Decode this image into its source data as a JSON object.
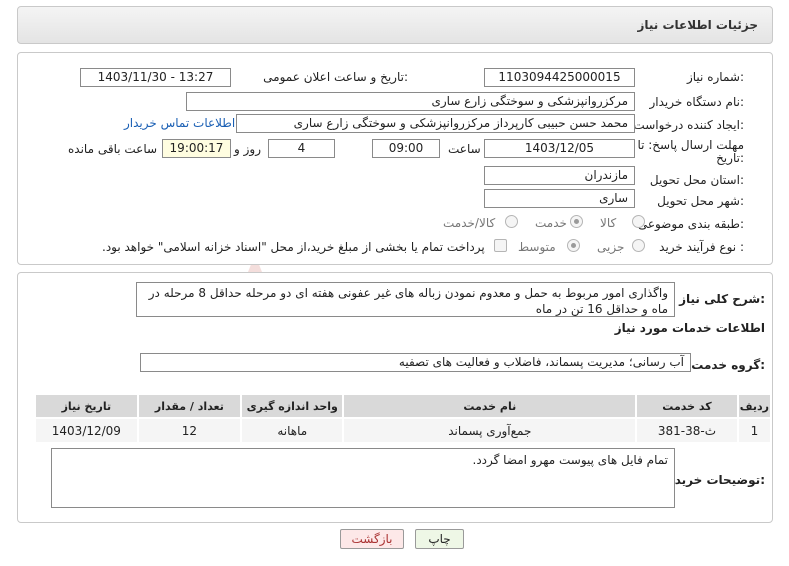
{
  "header": {
    "title": "جزئیات اطلاعات نیاز"
  },
  "fields": {
    "need_number_label": "شماره نیاز:",
    "need_number": "1103094425000015",
    "announce_label": "تاریخ و ساعت اعلان عمومی:",
    "announce_value": "1403/11/30 - 13:27",
    "buyer_org_label": "نام دستگاه خریدار:",
    "buyer_org": "مرکزروانپزشکی و سوختگی زارع ساری",
    "creator_label": "ایجاد کننده درخواست:",
    "creator": "محمد حسن حبیبی کارپرداز مرکزروانپزشکی و سوختگی زارع ساری",
    "contact_link": "اطلاعات تماس خریدار",
    "deadline_label_1": "مهلت ارسال پاسخ: تا",
    "deadline_label_2": "تاریخ:",
    "deadline_date": "1403/12/05",
    "time_label": "ساعت",
    "deadline_time": "09:00",
    "days_value": "4",
    "days_label": "روز و",
    "remaining_time": "19:00:17",
    "remaining_label": "ساعت باقی مانده",
    "province_label": "استان محل تحویل:",
    "province": "مازندران",
    "city_label": "شهر محل تحویل:",
    "city": "ساری",
    "category_label": "طبقه بندی موضوعی:",
    "category_options": [
      "کالا",
      "خدمت",
      "کالا/خدمت"
    ],
    "category_selected": "خدمت",
    "process_label": "نوع فرآیند خرید :",
    "process_options": [
      "جزیی",
      "متوسط"
    ],
    "process_selected": "متوسط",
    "payment_note": "پرداخت تمام یا بخشی از مبلغ خرید،از محل \"اسناد خزانه اسلامی\" خواهد بود."
  },
  "summary": {
    "label": "شرح کلی نیاز:",
    "text": "واگذاری امور مربوط به حمل و معدوم نمودن زباله های غیر عفونی هفته ای دو مرحله حداقل 8 مرحله در ماه و حداقل 16 تن در ماه"
  },
  "services": {
    "section_title": "اطلاعات خدمات مورد نیاز",
    "group_label": "گروه خدمت:",
    "group_value": "آب رسانی؛ مدیریت پسماند، فاضلاب و فعالیت های تصفیه",
    "columns": [
      "ردیف",
      "کد خدمت",
      "نام خدمت",
      "واحد اندازه گیری",
      "تعداد / مقدار",
      "تاریخ نیاز"
    ],
    "rows": [
      [
        "1",
        "ث-38-381",
        "جمع‌آوری پسماند",
        "ماهانه",
        "12",
        "1403/12/09"
      ]
    ]
  },
  "buyer_notes": {
    "label": "توضیحات خریدار:",
    "text": "تمام فایل های پیوست مهرو امضا گردد."
  },
  "buttons": {
    "print": "چاپ",
    "back": "بازگشت"
  },
  "colors": {
    "link": "#1a5fb4",
    "back_button_bg": "#fde8e8",
    "print_button_bg": "#eef7e6"
  }
}
